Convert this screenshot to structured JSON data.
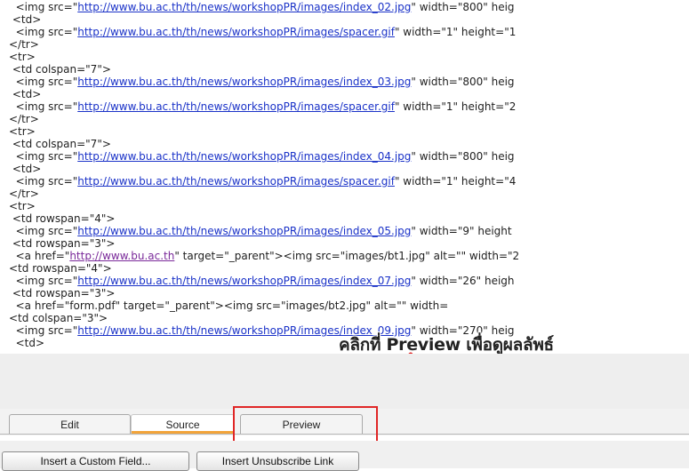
{
  "source_lines": [
    {
      "pre": "  <img src=\"",
      "link": "http://www.bu.ac.th/th/news/workshopPR/images/index_02.jpg",
      "post": "\" width=\"800\" heig"
    },
    {
      "pre": " <td>",
      "link": "",
      "post": ""
    },
    {
      "pre": "  <img src=\"",
      "link": "http://www.bu.ac.th/th/news/workshopPR/images/spacer.gif",
      "post": "\" width=\"1\" height=\"1"
    },
    {
      "pre": "</tr>",
      "link": "",
      "post": ""
    },
    {
      "pre": "<tr>",
      "link": "",
      "post": ""
    },
    {
      "pre": " <td colspan=\"7\">",
      "link": "",
      "post": ""
    },
    {
      "pre": "  <img src=\"",
      "link": "http://www.bu.ac.th/th/news/workshopPR/images/index_03.jpg",
      "post": "\" width=\"800\" heig"
    },
    {
      "pre": " <td>",
      "link": "",
      "post": ""
    },
    {
      "pre": "  <img src=\"",
      "link": "http://www.bu.ac.th/th/news/workshopPR/images/spacer.gif",
      "post": "\" width=\"1\" height=\"2"
    },
    {
      "pre": "</tr>",
      "link": "",
      "post": ""
    },
    {
      "pre": "<tr>",
      "link": "",
      "post": ""
    },
    {
      "pre": " <td colspan=\"7\">",
      "link": "",
      "post": ""
    },
    {
      "pre": "  <img src=\"",
      "link": "http://www.bu.ac.th/th/news/workshopPR/images/index_04.jpg",
      "post": "\" width=\"800\" heig"
    },
    {
      "pre": " <td>",
      "link": "",
      "post": ""
    },
    {
      "pre": "  <img src=\"",
      "link": "http://www.bu.ac.th/th/news/workshopPR/images/spacer.gif",
      "post": "\" width=\"1\" height=\"4"
    },
    {
      "pre": "</tr>",
      "link": "",
      "post": ""
    },
    {
      "pre": "<tr>",
      "link": "",
      "post": ""
    },
    {
      "pre": " <td rowspan=\"4\">",
      "link": "",
      "post": ""
    },
    {
      "pre": "  <img src=\"",
      "link": "http://www.bu.ac.th/th/news/workshopPR/images/index_05.jpg",
      "post": "\" width=\"9\" height"
    },
    {
      "pre": " <td rowspan=\"3\">",
      "link": "",
      "post": ""
    },
    {
      "pre": "  <a href=\"",
      "link": "http://www.bu.ac.th",
      "post": "\" target=\"_parent\"><img src=\"images/bt1.jpg\" alt=\"\" width=\"2"
    },
    {
      "pre": "<td rowspan=\"4\">",
      "link": "",
      "post": ""
    },
    {
      "pre": "  <img src=\"",
      "link": "http://www.bu.ac.th/th/news/workshopPR/images/index_07.jpg",
      "post": "\" width=\"26\" heigh"
    },
    {
      "pre": " <td rowspan=\"3\">",
      "link": "",
      "post": ""
    },
    {
      "pre": "  <a href=\"form.pdf\" target=\"_parent\"><img src=\"images/bt2.jpg\" alt=\"\" width=",
      "link": "",
      "post": ""
    },
    {
      "pre": "<td colspan=\"3\">",
      "link": "",
      "post": ""
    },
    {
      "pre": "  <img src=\"",
      "link": "http://www.bu.ac.th/th/news/workshopPR/images/index_09.jpg",
      "post": "\" width=\"270\" heig"
    },
    {
      "pre": "  <td>",
      "link": "",
      "post": ""
    }
  ],
  "annotation": {
    "text": "คลิกที่ Preview เพื่อดูผลลัพธ์",
    "arrow_color": "#e02626"
  },
  "tabs": [
    {
      "label": "Edit"
    },
    {
      "label": "Source"
    },
    {
      "label": "Preview"
    }
  ],
  "active_tab": "Source",
  "buttons": {
    "insert_custom_field": "Insert a Custom Field...",
    "insert_unsubscribe_link": "Insert Unsubscribe Link"
  },
  "colors": {
    "link": "#1a32c8",
    "visited_link": "#7a2a9a",
    "highlight": "#e02626",
    "active_tab_accent": "#f2a43a"
  }
}
